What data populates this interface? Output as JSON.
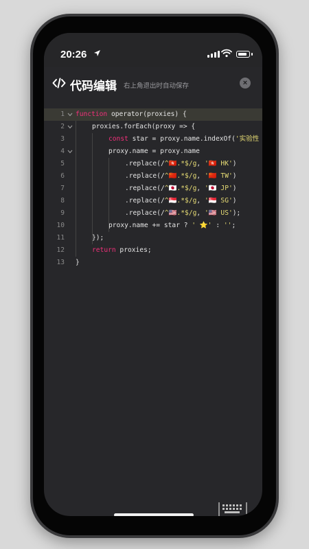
{
  "status_bar": {
    "time": "20:26"
  },
  "header": {
    "title": "代码编辑",
    "subtitle": "右上角退出时自动保存",
    "close_symbol": "×"
  },
  "editor": {
    "lines": [
      {
        "num": "1",
        "fold": true,
        "indent": 0,
        "tokens": [
          {
            "t": "function",
            "c": "kw"
          },
          {
            "t": " operator(proxies) {",
            "c": "fn"
          }
        ]
      },
      {
        "num": "2",
        "fold": true,
        "indent": 1,
        "tokens": [
          {
            "t": "proxies.forEach(proxy => {",
            "c": "fn"
          }
        ]
      },
      {
        "num": "3",
        "fold": false,
        "indent": 2,
        "tokens": [
          {
            "t": "const",
            "c": "kw"
          },
          {
            "t": " star = proxy.name.indexOf(",
            "c": "fn"
          },
          {
            "t": "'实验性",
            "c": "str"
          }
        ]
      },
      {
        "num": "4",
        "fold": true,
        "indent": 2,
        "tokens": [
          {
            "t": "proxy.name = proxy.name",
            "c": "fn"
          }
        ]
      },
      {
        "num": "5",
        "fold": false,
        "indent": 3,
        "tokens": [
          {
            "t": ".replace(/",
            "c": "fn"
          },
          {
            "t": "^🇭🇰.*$/g",
            "c": "str"
          },
          {
            "t": ", ",
            "c": "fn"
          },
          {
            "t": "'🇭🇰 HK'",
            "c": "str"
          },
          {
            "t": ")",
            "c": "fn"
          }
        ]
      },
      {
        "num": "6",
        "fold": false,
        "indent": 3,
        "tokens": [
          {
            "t": ".replace(/",
            "c": "fn"
          },
          {
            "t": "^🇨🇳.*$/g",
            "c": "str"
          },
          {
            "t": ", ",
            "c": "fn"
          },
          {
            "t": "'🇨🇳 TW'",
            "c": "str"
          },
          {
            "t": ")",
            "c": "fn"
          }
        ]
      },
      {
        "num": "7",
        "fold": false,
        "indent": 3,
        "tokens": [
          {
            "t": ".replace(/",
            "c": "fn"
          },
          {
            "t": "^🇯🇵.*$/g",
            "c": "str"
          },
          {
            "t": ", ",
            "c": "fn"
          },
          {
            "t": "'🇯🇵 JP'",
            "c": "str"
          },
          {
            "t": ")",
            "c": "fn"
          }
        ]
      },
      {
        "num": "8",
        "fold": false,
        "indent": 3,
        "tokens": [
          {
            "t": ".replace(/",
            "c": "fn"
          },
          {
            "t": "^🇸🇬.*$/g",
            "c": "str"
          },
          {
            "t": ", ",
            "c": "fn"
          },
          {
            "t": "'🇸🇬 SG'",
            "c": "str"
          },
          {
            "t": ")",
            "c": "fn"
          }
        ]
      },
      {
        "num": "9",
        "fold": false,
        "indent": 3,
        "tokens": [
          {
            "t": ".replace(/",
            "c": "fn"
          },
          {
            "t": "^🇺🇸.*$/g",
            "c": "str"
          },
          {
            "t": ", ",
            "c": "fn"
          },
          {
            "t": "'🇺🇸 US'",
            "c": "str"
          },
          {
            "t": ");",
            "c": "fn"
          }
        ]
      },
      {
        "num": "10",
        "fold": false,
        "indent": 2,
        "tokens": [
          {
            "t": "proxy.name += star ? ",
            "c": "fn"
          },
          {
            "t": "' ⭐'",
            "c": "str"
          },
          {
            "t": " : ",
            "c": "fn"
          },
          {
            "t": "''",
            "c": "str"
          },
          {
            "t": ";",
            "c": "fn"
          }
        ]
      },
      {
        "num": "11",
        "fold": false,
        "indent": 1,
        "tokens": [
          {
            "t": "});",
            "c": "fn"
          }
        ]
      },
      {
        "num": "12",
        "fold": false,
        "indent": 1,
        "tokens": [
          {
            "t": "return",
            "c": "kw"
          },
          {
            "t": " proxies;",
            "c": "fn"
          }
        ]
      },
      {
        "num": "13",
        "fold": false,
        "indent": 0,
        "tokens": [
          {
            "t": "}",
            "c": "fn"
          }
        ]
      }
    ]
  },
  "colors": {
    "keyword": "#f0307a",
    "string": "#e6db74",
    "text": "#e6e6e6",
    "background": "#27272a"
  },
  "icons": [
    "location-arrow-icon",
    "signal-icon",
    "wifi-icon",
    "battery-icon",
    "code-icon",
    "close-icon",
    "chevron-down-icon",
    "keyboard-icon"
  ]
}
